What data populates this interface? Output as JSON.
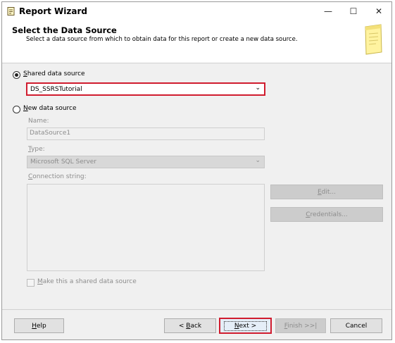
{
  "window": {
    "title": "Report Wizard",
    "minimize_glyph": "—",
    "maximize_glyph": "☐",
    "close_glyph": "✕"
  },
  "header": {
    "title": "Select the Data Source",
    "subtitle": "Select a data source from which to obtain data for this report or create a new data source.",
    "icon": "document-icon"
  },
  "shared": {
    "label_accel": "S",
    "label_rest": "hared data source",
    "selected": true,
    "value": "DS_SSRSTutorial"
  },
  "new_source": {
    "label_accel": "N",
    "label_rest": "ew data source",
    "selected": false,
    "name_label": "Name:",
    "name_value": "DataSource1",
    "type_label_accel": "T",
    "type_label_rest": "ype:",
    "type_value": "Microsoft SQL Server",
    "conn_label_accel": "C",
    "conn_label_rest": "onnection string:",
    "conn_value": "",
    "edit_label_accel": "E",
    "edit_label_rest": "dit...",
    "cred_label_accel": "C",
    "cred_label_rest": "redentials...",
    "make_shared_accel": "M",
    "make_shared_rest": "ake this a shared data source",
    "make_shared_checked": false
  },
  "footer": {
    "help_accel": "H",
    "help_rest": "elp",
    "back_pre": "< ",
    "back_accel": "B",
    "back_rest": "ack",
    "next_accel": "N",
    "next_rest": "ext >",
    "finish_accel": "F",
    "finish_rest": "inish >>|",
    "cancel": "Cancel"
  },
  "colors": {
    "highlight": "#d01c2e",
    "dialog_bg": "#f0f0f0"
  }
}
